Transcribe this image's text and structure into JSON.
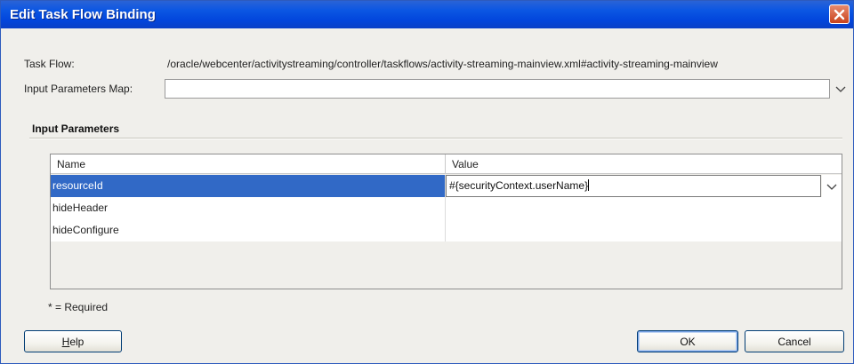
{
  "window": {
    "title": "Edit Task Flow Binding"
  },
  "form": {
    "task_flow_label": "Task Flow:",
    "task_flow_value": "/oracle/webcenter/activitystreaming/controller/taskflows/activity-streaming-mainview.xml#activity-streaming-mainview",
    "input_params_map_label": "Input Parameters Map:",
    "input_params_map_value": ""
  },
  "input_parameters": {
    "section_title": "Input Parameters",
    "columns": [
      "Name",
      "Value"
    ],
    "rows": [
      {
        "name": "resourceId",
        "value": "#{securityContext.userName}",
        "selected": true
      },
      {
        "name": "hideHeader",
        "value": ""
      },
      {
        "name": "hideConfigure",
        "value": ""
      }
    ]
  },
  "required_note": "* = Required",
  "buttons": {
    "help_first": "H",
    "help_rest": "elp",
    "ok": "OK",
    "cancel": "Cancel"
  },
  "icons": {
    "close": "close-icon",
    "dropdown": "chevron-down-icon"
  },
  "colors": {
    "title_bar": "#0b56e3",
    "selection": "#3169c6",
    "close_button": "#c8431d"
  }
}
